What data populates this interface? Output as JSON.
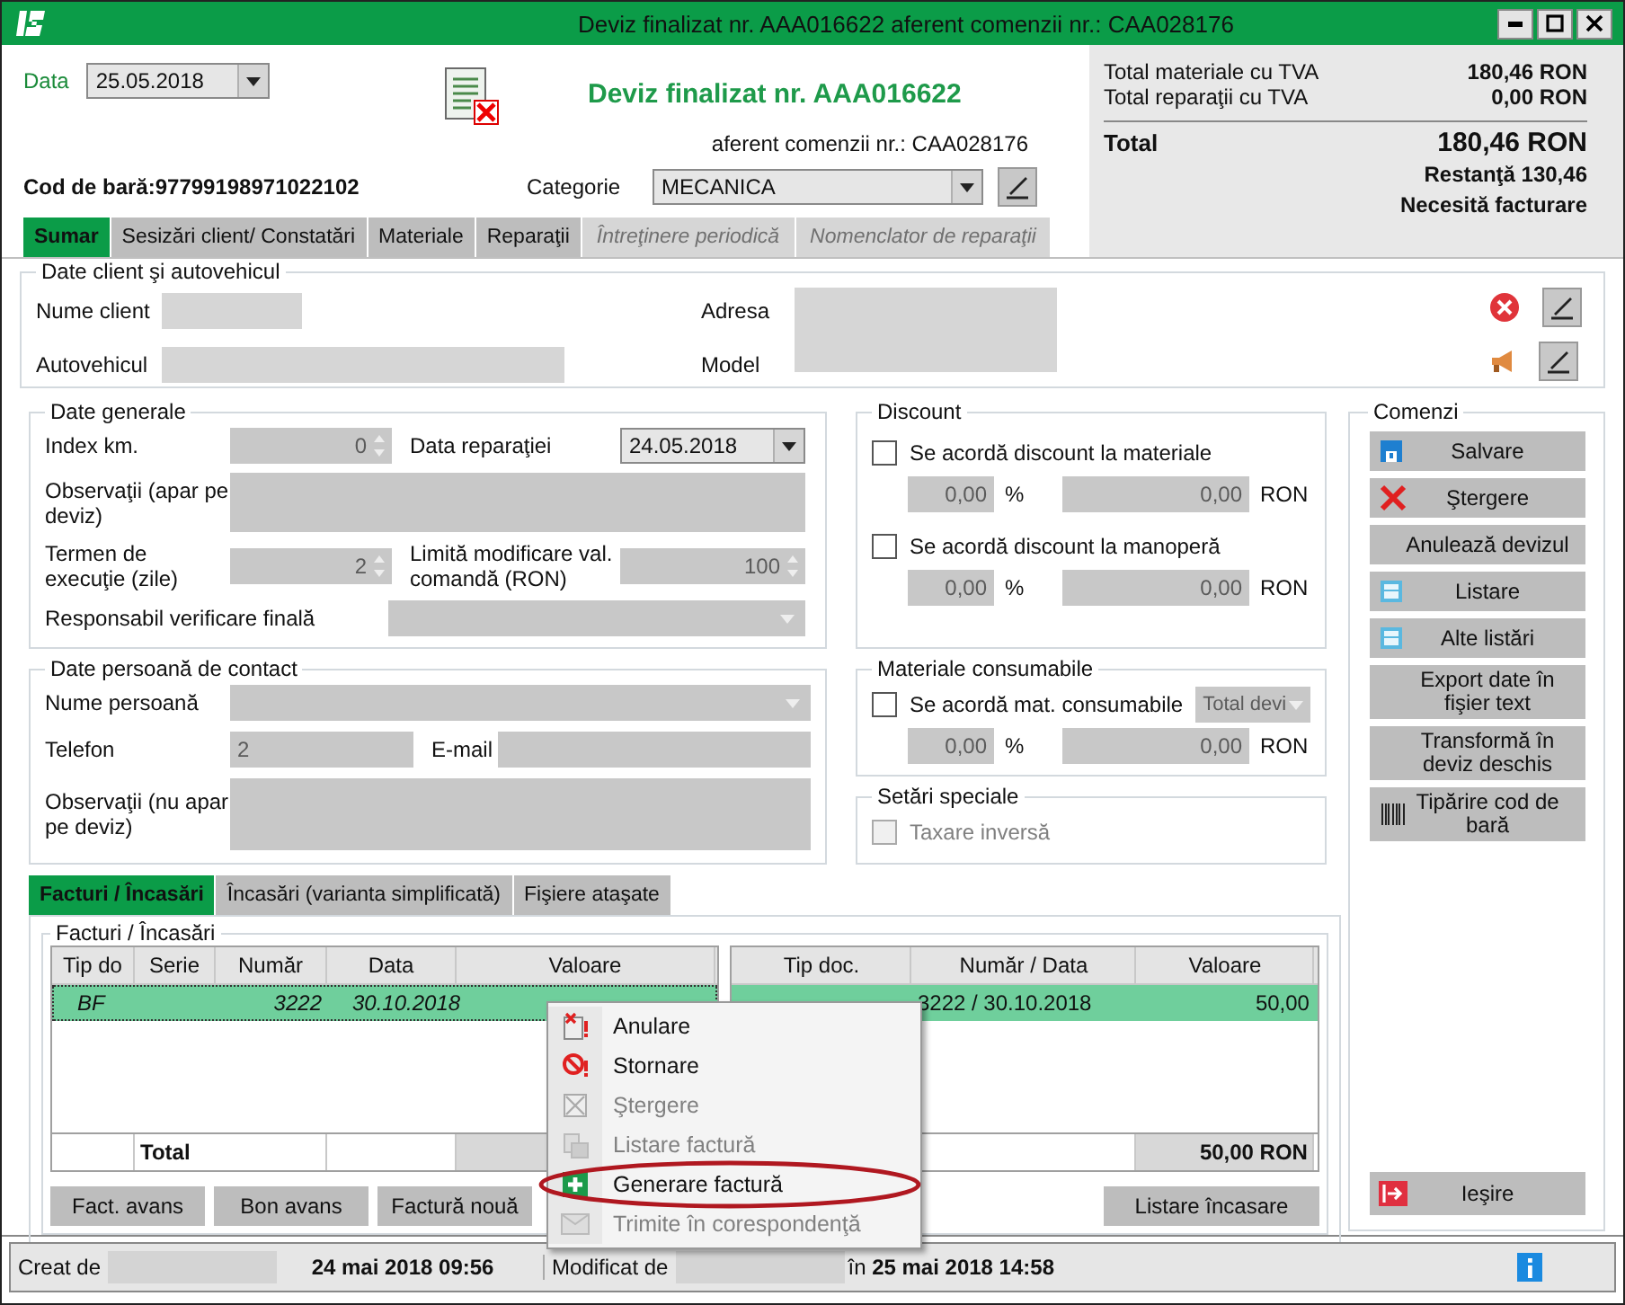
{
  "window": {
    "title": "Deviz finalizat nr. AAA016622 aferent comenzii nr.: CAA028176"
  },
  "header": {
    "date_label": "Data",
    "date": "25.05.2018",
    "title": "Deviz finalizat nr. AAA016622",
    "subtitle": "aferent comenzii nr.: CAA028176",
    "barcode": "Cod de bară:97799198971022102",
    "category_label": "Categorie",
    "category": "MECANICA"
  },
  "totals": {
    "rows": [
      {
        "label": "Total materiale cu TVA",
        "value": "180,46 RON"
      },
      {
        "label": "Total reparaţii cu TVA",
        "value": "0,00 RON"
      }
    ],
    "total_label": "Total",
    "total": "180,46 RON",
    "remaining": "Restanţă 130,46",
    "status": "Necesită facturare"
  },
  "tabs": [
    {
      "label": "Sumar",
      "selected": true,
      "disabled": false
    },
    {
      "label": "Sesizări client/ Constatări",
      "selected": false,
      "disabled": false
    },
    {
      "label": "Materiale",
      "selected": false,
      "disabled": false
    },
    {
      "label": "Reparaţii",
      "selected": false,
      "disabled": false
    },
    {
      "label": "Întreţinere periodică",
      "selected": false,
      "disabled": true
    },
    {
      "label": "Nomenclator de reparaţii",
      "selected": false,
      "disabled": true
    }
  ],
  "client": {
    "title": "Date client şi autovehicul",
    "labels": [
      "Nume client",
      "Autovehicul",
      "Adresa",
      "Model"
    ]
  },
  "general": {
    "title": "Date generale",
    "index_label": "Index km.",
    "index": "0",
    "repair_date_label": "Data reparaţiei",
    "repair_date": "24.05.2018",
    "notes_label": "Observaţii (apar pe deviz)",
    "term_label": "Termen de execuţie (zile)",
    "term": "2",
    "limit_label": "Limită modificare val. comandă (RON)",
    "limit": "100",
    "responsible_label": "Responsabil verificare finală"
  },
  "discount": {
    "title": "Discount",
    "rows": [
      {
        "label": "Se acordă discount la materiale",
        "checked": false,
        "percent": "0,00",
        "percent_unit": "%",
        "amount": "0,00",
        "currency": "RON"
      },
      {
        "label": "Se acordă discount la manoperă",
        "checked": false,
        "percent": "0,00",
        "percent_unit": "%",
        "amount": "0,00",
        "currency": "RON"
      }
    ]
  },
  "contact": {
    "title": "Date persoană de contact",
    "name_label": "Nume persoană",
    "phone_label": "Telefon",
    "phone": "2",
    "email_label": "E-mail",
    "notes_label": "Observaţii (nu apar pe deviz)"
  },
  "consumables": {
    "title": "Materiale consumabile",
    "label": "Se acordă mat. consumabile",
    "checked": false,
    "mode": "Total devi",
    "percent": "0,00",
    "percent_unit": "%",
    "amount": "0,00",
    "currency": "RON"
  },
  "special": {
    "title": "Setări speciale",
    "label": "Taxare inversă",
    "checked": false,
    "disabled": true
  },
  "commands": {
    "title": "Comenzi",
    "buttons": [
      {
        "label": "Salvare",
        "kind": "save"
      },
      {
        "label": "Ştergere",
        "kind": "delete"
      },
      {
        "label": "Anulează devizul",
        "kind": "plain"
      },
      {
        "label": "Listare",
        "kind": "print"
      },
      {
        "label": "Alte listări",
        "kind": "print"
      },
      {
        "label": "Export date în fişier text",
        "kind": "plain"
      },
      {
        "label": "Transformă în deviz deschis",
        "kind": "plain"
      },
      {
        "label": "Tipărire cod de bară",
        "kind": "barcode"
      }
    ],
    "exit": "Ieşire"
  },
  "bottom_tabs": [
    {
      "label": "Facturi / Încasări",
      "selected": true
    },
    {
      "label": "Încasări (varianta simplificată)",
      "selected": false
    },
    {
      "label": "Fişiere ataşate",
      "selected": false
    }
  ],
  "invoices": {
    "title": "Facturi / Încasări",
    "columns": [
      "Tip do",
      "Serie",
      "Număr",
      "Data",
      "Valoare"
    ],
    "rows": [
      {
        "type": "BF",
        "number": "3222",
        "date": "30.10.2018",
        "selected": true
      }
    ],
    "total_label": "Total"
  },
  "payments": {
    "columns": [
      "Tip doc.",
      "Număr / Data",
      "Valoare"
    ],
    "rows": [
      {
        "number_date": "3222 / 30.10.2018",
        "value": "50,00",
        "selected": true
      }
    ],
    "total": "50,00 RON"
  },
  "invoice_buttons": [
    "Fact. avans",
    "Bon avans",
    "Factură nouă"
  ],
  "list_button": "Listare încasare",
  "context_menu": {
    "items": [
      {
        "label": "Anulare",
        "kind": "cancel",
        "disabled": false,
        "highlighted": false
      },
      {
        "label": "Stornare",
        "kind": "reverse",
        "disabled": false,
        "highlighted": false
      },
      {
        "label": "Ştergere",
        "kind": "delete",
        "disabled": true,
        "highlighted": false
      },
      {
        "label": "Listare factură",
        "kind": "print",
        "disabled": true,
        "highlighted": false
      },
      {
        "label": "Generare factură",
        "kind": "add",
        "disabled": false,
        "highlighted": true
      },
      {
        "label": "Trimite în corespondenţă",
        "kind": "mail",
        "disabled": true,
        "highlighted": false
      }
    ]
  },
  "status_bar": {
    "created_label": "Creat de",
    "created": "24 mai 2018 09:56",
    "modified_label": "Modificat de",
    "modified": "în **25 mai 2018 14:58**"
  }
}
